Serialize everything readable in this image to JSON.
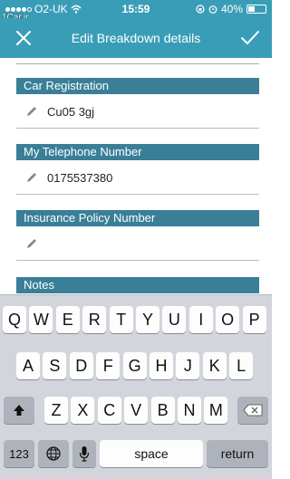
{
  "status_bar": {
    "carrier": "O2-UK",
    "time": "15:59",
    "battery_percent": "40%",
    "battery_level": 0.4,
    "watermark": "1Car.ir"
  },
  "nav": {
    "title": "Edit Breakdown details",
    "close_icon": "close-icon",
    "done_icon": "checkmark-icon"
  },
  "fields": {
    "car_registration": {
      "label": "Car Registration",
      "value": "Cu05 3gj"
    },
    "telephone": {
      "label": "My Telephone Number",
      "value": "0175537380"
    },
    "insurance": {
      "label": "Insurance Policy Number",
      "value": ""
    },
    "notes": {
      "label": "Notes"
    }
  },
  "keyboard": {
    "row1": [
      "Q",
      "W",
      "E",
      "R",
      "T",
      "Y",
      "U",
      "I",
      "O",
      "P"
    ],
    "row2": [
      "A",
      "S",
      "D",
      "F",
      "G",
      "H",
      "J",
      "K",
      "L"
    ],
    "row3": [
      "Z",
      "X",
      "C",
      "V",
      "B",
      "N",
      "M"
    ],
    "numbers_label": "123",
    "space_label": "space",
    "return_label": "return"
  },
  "colors": {
    "header": "#3a9db8",
    "section_header": "#3a7f98"
  }
}
